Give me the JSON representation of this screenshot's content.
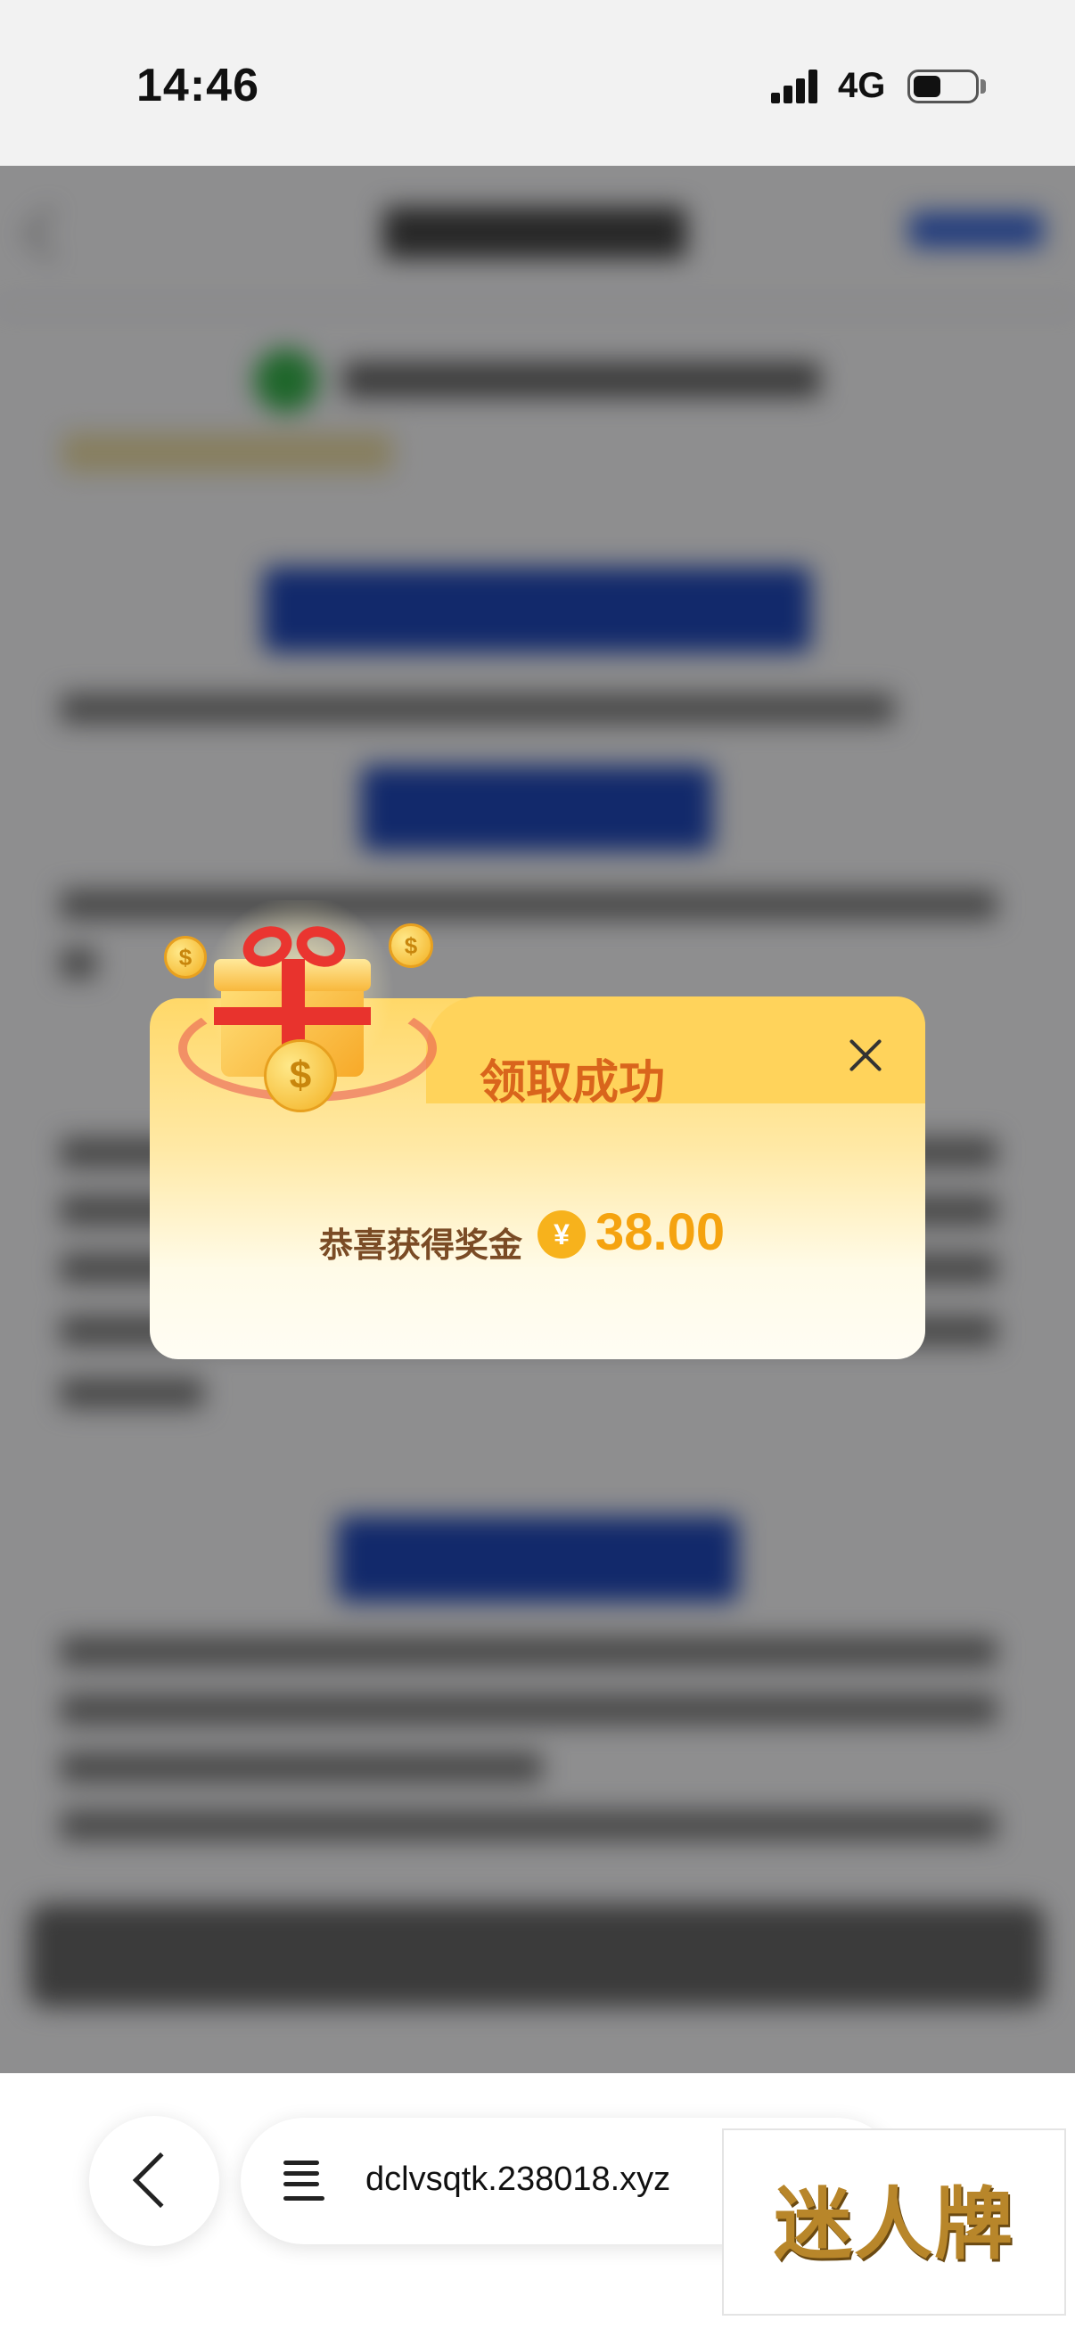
{
  "status_bar": {
    "time": "14:46",
    "network": "4G"
  },
  "popup": {
    "title": "领取成功",
    "reward_text": "恭喜获得奖金",
    "currency_symbol": "¥",
    "amount": "38.00",
    "close_icon": "close-icon"
  },
  "browser": {
    "url": "dclvsqtk.238018.xyz",
    "back_icon": "chevron-left-icon",
    "page_icon": "page-menu-icon"
  },
  "watermark": {
    "text": "迷人牌"
  },
  "colors": {
    "popup_title": "#d9651c",
    "amount": "#f5a30f",
    "accent_blue": "#1f47b8"
  }
}
